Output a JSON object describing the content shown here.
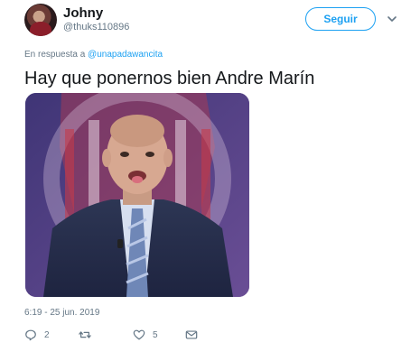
{
  "user": {
    "name": "Johny",
    "handle": "@thuks110896"
  },
  "follow_label": "Seguir",
  "reply_context": {
    "prefix": "En respuesta a",
    "mention": "@unapadawancita"
  },
  "tweet": {
    "text": "Hay que ponernos bien Andre Marín",
    "timestamp": "6:19 - 25 jun. 2019"
  },
  "actions": {
    "replies": "2",
    "retweets": "",
    "likes": "5"
  },
  "colors": {
    "accent": "#1da1f2",
    "secondary_text": "#657786",
    "primary_text": "#14171a"
  },
  "icons": {
    "reply": "reply-icon",
    "retweet": "retweet-icon",
    "like": "heart-icon",
    "dm": "envelope-icon",
    "more": "chevron-down-icon"
  }
}
